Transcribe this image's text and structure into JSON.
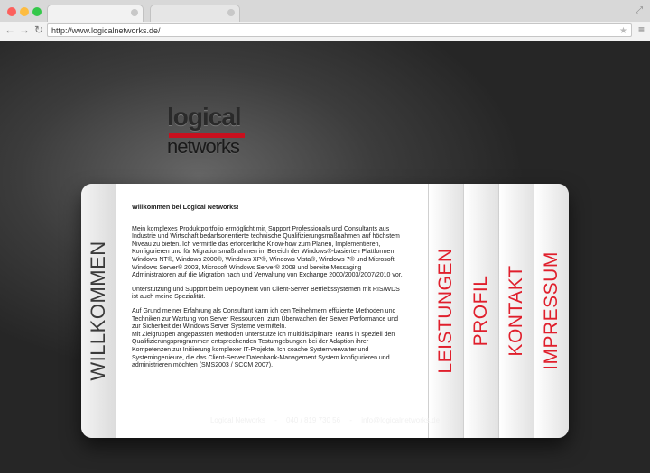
{
  "browser": {
    "url": "http://www.logicalnetworks.de/",
    "nav_back": "←",
    "nav_forward": "→",
    "nav_reload": "↻",
    "star": "★",
    "menu": "≡",
    "win_icon": "⤢"
  },
  "logo": {
    "top": "logical",
    "bottom": "networks"
  },
  "sidebar_left": "WILLKOMMEN",
  "content": {
    "heading": "Willkommen bei Logical Networks!",
    "p1": "Mein komplexes Produktportfolio ermöglicht mir, Support Professionals und Consultants aus Industrie und Wirtschaft bedarfsorientierte technische Qualifizierungsmaßnahmen auf höchstem Niveau zu bieten. Ich vermittle das erforderliche Know-how zum Planen, Implementieren, Konfigurieren und für Migrationsmaßnahmen im Bereich der Windows®-basierten Plattformen Windows NT®, Windows 2000®, Windows XP®, Windows Vista®, Windows 7® und Microsoft Windows Server® 2003, Microsoft Windows Server® 2008 und bereite Messaging Administratoren auf die Migration nach und Verwaltung von Exchange 2000/2003/2007/2010 vor.",
    "p2": "Unterstützung und Support beim Deployment von Client-Server Betriebssystemen mit RIS/WDS ist auch meine Spezialität.",
    "p3": "Auf Grund meiner Erfahrung als Consultant kann ich den Teilnehmern effiziente Methoden und Techniken zur Wartung von Server Ressourcen, zum Überwachen der Server Performance und zur Sicherheit der Windows Server Systeme vermitteln.",
    "p4": "Mit Zielgruppen angepassten Methoden unterstütze ich multidisziplinäre Teams in speziell den Qualifizierungsprogrammen entsprechenden Testumgebungen bei der Adaption ihrer Kompetenzen zur Initiierung komplexer IT-Projekte. Ich coache Systemverwalter und Systemingenieure, die das Client-Server Datenbank-Management System konfigurieren und administrieren möchten (SMS2003 / SCCM 2007)."
  },
  "tabs": [
    "LEISTUNGEN",
    "PROFIL",
    "KONTAKT",
    "IMPRESSUM"
  ],
  "footer": {
    "company": "Logical Networks",
    "separator": "-",
    "phone": "040 / 819 730 56",
    "email": "info@logicalnetworks.de"
  }
}
